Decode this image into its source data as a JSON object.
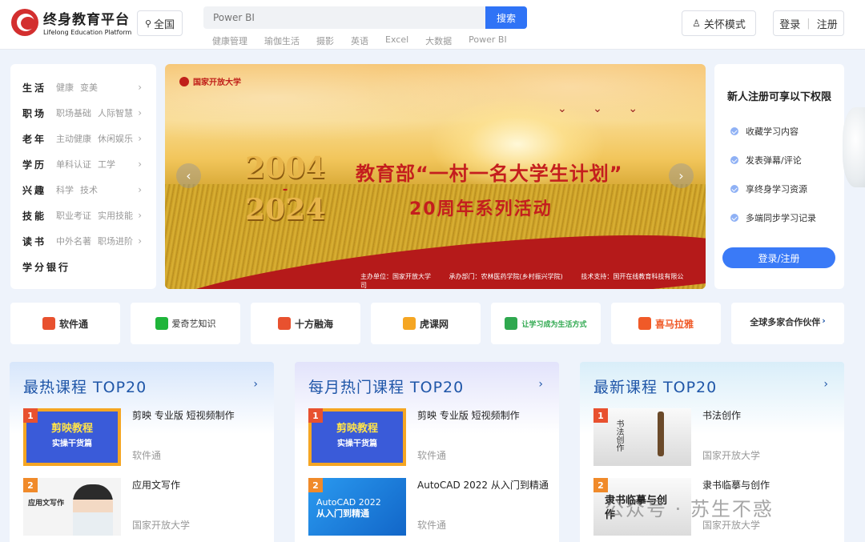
{
  "header": {
    "logo_cn": "终身教育平台",
    "logo_en": "Lifelong Education Platform",
    "region": "全国",
    "search_placeholder": "Power BI",
    "search_button": "搜索",
    "hotwords": [
      "健康管理",
      "瑜伽生活",
      "摄影",
      "英语",
      "Excel",
      "大数据",
      "Power BI"
    ],
    "care_mode": "关怀模式",
    "login": "登录",
    "register": "注册"
  },
  "categories": [
    {
      "title": "生活",
      "subs": [
        "健康",
        "变美"
      ]
    },
    {
      "title": "职场",
      "subs": [
        "职场基础",
        "人际智慧"
      ]
    },
    {
      "title": "老年",
      "subs": [
        "主动健康",
        "休闲娱乐"
      ]
    },
    {
      "title": "学历",
      "subs": [
        "单科认证",
        "工学"
      ]
    },
    {
      "title": "兴趣",
      "subs": [
        "科学",
        "技术"
      ]
    },
    {
      "title": "技能",
      "subs": [
        "职业考证",
        "实用技能"
      ]
    },
    {
      "title": "读书",
      "subs": [
        "中外名著",
        "职场进阶"
      ]
    },
    {
      "title": "学分银行",
      "subs": []
    }
  ],
  "banner": {
    "org": "国家开放大学",
    "year_start": "2004",
    "year_dash": "-",
    "year_end": "2024",
    "title": "教育部“一村一名大学生计划”",
    "subtitle": "20周年系列活动",
    "footer": [
      "主办单位：国家开放大学",
      "承办部门：农林医药学院(乡村振兴学院)",
      "技术支持：国开在线教育科技有限公司"
    ]
  },
  "perks": {
    "title": "新人注册可享以下权限",
    "items": [
      "收藏学习内容",
      "发表弹幕/评论",
      "享终身学习资源",
      "多端同步学习记录"
    ],
    "button": "登录/注册"
  },
  "partners": [
    {
      "name": "软件通",
      "color": "#e8512f"
    },
    {
      "name": "爱奇艺知识",
      "color": "#1fb53a"
    },
    {
      "name": "十方融海",
      "color": "#e8512f"
    },
    {
      "name": "虎课网",
      "color": "#f5a623"
    },
    {
      "name": "让学习成为生活方式",
      "color": "#2fa84f"
    },
    {
      "name": "喜马拉雅",
      "color": "#f05a28"
    },
    {
      "name": "全球多家合作伙伴",
      "color": "#1f56a8"
    }
  ],
  "panels": [
    {
      "title": "最热课程 TOP20",
      "courses": [
        {
          "rank": "1",
          "title": "剪映 专业版 短视频制作",
          "source": "软件通",
          "thumb": "剪映教程",
          "thumb_sub": "实操干货篇"
        },
        {
          "rank": "2",
          "title": "应用文写作",
          "source": "国家开放大学",
          "thumb": "应用文写作"
        }
      ]
    },
    {
      "title": "每月热门课程 TOP20",
      "courses": [
        {
          "rank": "1",
          "title": "剪映 专业版 短视频制作",
          "source": "软件通",
          "thumb": "剪映教程",
          "thumb_sub": "实操干货篇"
        },
        {
          "rank": "2",
          "title": "AutoCAD 2022 从入门到精通",
          "source": "软件通",
          "thumb": "AutoCAD 2022",
          "thumb_sub": "从入门到精通"
        }
      ]
    },
    {
      "title": "最新课程 TOP20",
      "courses": [
        {
          "rank": "1",
          "title": "书法创作",
          "source": "国家开放大学",
          "thumb": "书法创作"
        },
        {
          "rank": "2",
          "title": "隶书临摹与创作",
          "source": "国家开放大学",
          "thumb": "隶书临摹与创作"
        }
      ]
    }
  ],
  "watermark": "公众号 · 苏生不惑"
}
